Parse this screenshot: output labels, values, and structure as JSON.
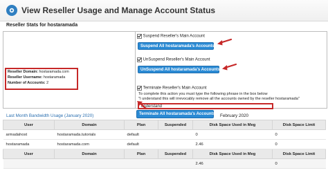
{
  "header": {
    "title": "View Reseller Usage and Manage Account Status"
  },
  "section": {
    "title": "Reseller Stats for hostaramada"
  },
  "reseller_info": {
    "domain_label": "Reseller Domain:",
    "domain_value": "hostaramada.com",
    "username_label": "Reseller Username:",
    "username_value": "hostaramada",
    "accounts_label": "Number of Accounts:",
    "accounts_value": "2"
  },
  "actions": {
    "suspend_label": "Suspend Reseller's Main Account",
    "suspend_button": "Suspend All hostaramada's Accounts",
    "unsuspend_label": "UnSuspend Reseller's Main Account",
    "unsuspend_button": "UnSuspend All hostaramada's Accounts",
    "terminate_label": "Terminate Reseller's Main Account",
    "terminate_notice_1": "To complete this action you must type the following phrase in the box below",
    "terminate_notice_2": "\"I understand this will irrevocably remove all the accounts owned by the reseller hostaramada\"",
    "phrase_value": "understand",
    "terminate_button": "Terminate All hostaramada's Accounts"
  },
  "bandwidth": {
    "link": "Last Month Bandwidth Usage (January 2020)",
    "month": "February 2020",
    "columns": [
      "User",
      "Domain",
      "Plan",
      "Suspended",
      "Disk Space Used in Meg",
      "Disk Space Limit"
    ],
    "rows": [
      [
        "armadahost",
        "hostaramada.tutorials",
        "default",
        "",
        "0",
        "0"
      ],
      [
        "hostaramada",
        "hostaramada.com",
        "default",
        "",
        "2.46",
        "0"
      ]
    ],
    "totals": [
      "",
      "",
      "",
      "",
      "2.46",
      "0"
    ]
  },
  "colors": {
    "button": "#2a8ad4",
    "highlight": "#c62828",
    "link": "#2a6fb0"
  }
}
